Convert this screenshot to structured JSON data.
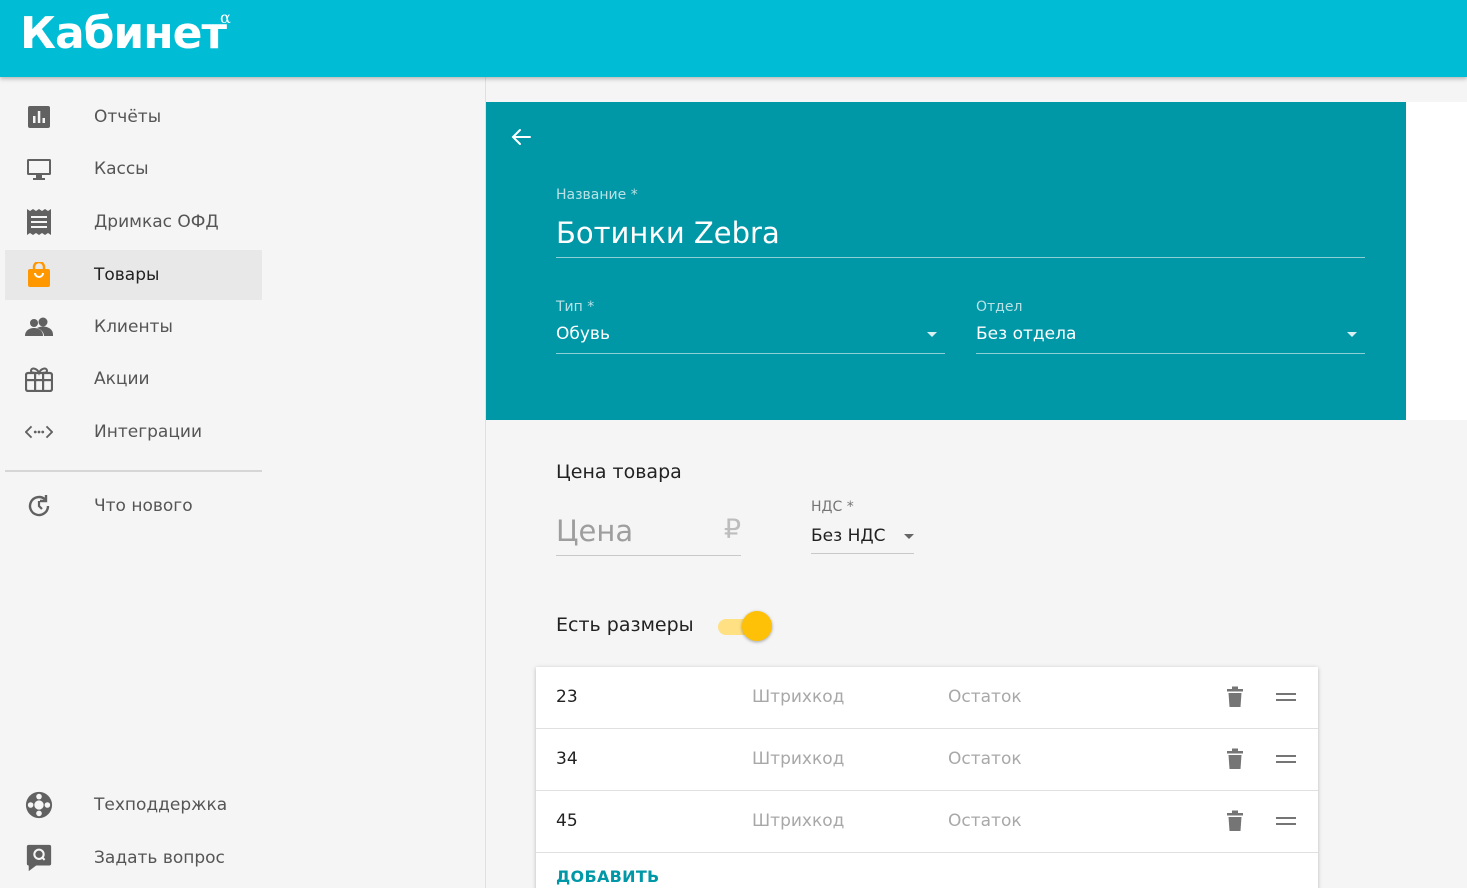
{
  "app": {
    "logo": "Кабинет",
    "logo_sup": "α"
  },
  "sidebar": {
    "items": [
      {
        "label": "Отчёты",
        "icon": "bar-chart-icon"
      },
      {
        "label": "Кассы",
        "icon": "monitor-icon"
      },
      {
        "label": "Дримкас ОФД",
        "icon": "receipt-icon"
      },
      {
        "label": "Товары",
        "icon": "shopping-bag-icon",
        "active": true
      },
      {
        "label": "Клиенты",
        "icon": "people-icon"
      },
      {
        "label": "Акции",
        "icon": "gift-card-icon"
      },
      {
        "label": "Интеграции",
        "icon": "code-arrows-icon"
      },
      {
        "label": "Что нового",
        "icon": "history-icon"
      }
    ],
    "bottom": [
      {
        "label": "Техподдержка",
        "icon": "lifebuoy-icon"
      },
      {
        "label": "Задать вопрос",
        "icon": "chat-question-icon"
      }
    ]
  },
  "product": {
    "name_label": "Название *",
    "name_value": "Ботинки Zebra",
    "type_label": "Тип *",
    "type_value": "Обувь",
    "dept_label": "Отдел",
    "dept_value": "Без отдела"
  },
  "price": {
    "section_title": "Цена товара",
    "placeholder": "Цена",
    "currency": "₽",
    "nds_label": "НДС *",
    "nds_value": "Без НДС"
  },
  "sizes": {
    "label": "Есть размеры",
    "enabled": true,
    "rows": [
      {
        "size": "23",
        "barcode_placeholder": "Штрихкод",
        "stock_placeholder": "Остаток"
      },
      {
        "size": "34",
        "barcode_placeholder": "Штрихкод",
        "stock_placeholder": "Остаток"
      },
      {
        "size": "45",
        "barcode_placeholder": "Штрихкод",
        "stock_placeholder": "Остаток"
      }
    ],
    "add_label": "ДОБАВИТЬ"
  },
  "colors": {
    "topbar": "#00bcd4",
    "header_card": "#0097a7",
    "accent": "#ffc107",
    "active_icon": "#ff9800"
  }
}
